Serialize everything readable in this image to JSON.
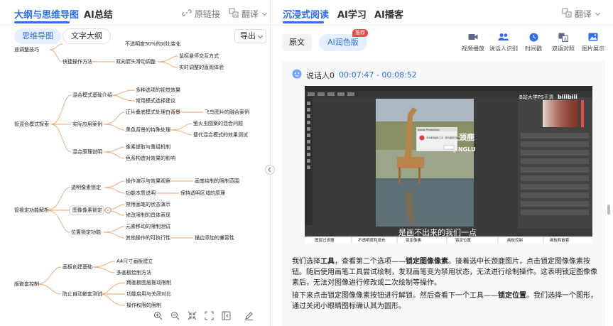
{
  "left": {
    "tabs": [
      "大纲与思维导图",
      "AI总结"
    ],
    "actions": {
      "link": "原链接",
      "translate": "翻译"
    },
    "view_modes": [
      "思维导图",
      "文字大纲"
    ],
    "export": "导出"
  },
  "mindmap": {
    "n1": "不透明度50%的对比变化",
    "n2": "遥调整技巧",
    "n3": "快捷操作方法",
    "n4": "双向箭头滑动调整",
    "n5": "鼠标悬停交互方式",
    "n6": "实时调整的直观体验",
    "n7": "混合模式基础介绍",
    "n8": "多种选项的视觉效果",
    "n9": "常用模式选择建议",
    "n10": "管混合模式探索",
    "n11": "实际应用案例",
    "n12": "正片叠底模式处理白背景",
    "n13": "飞鸟图片的融合案例",
    "n14": "黑色背景的特殊处理",
    "n15": "萤火虫图案的混合问题",
    "n16": "替代混合模式的效果测试",
    "n17": "混合原理说明",
    "n18": "像素提取与重组机制",
    "n19": "色系构造对效果的影响",
    "n20": "透明像素锁定",
    "n21": "操作演示与效果观察",
    "n22": "画笔绘制的限制范围",
    "n23": "功能本质说明",
    "n24": "保持透明区域的原理",
    "n25": "管锁定功能解析",
    "n26": "图像像素锁定",
    "n27": "禁用画笔的状态演示",
    "n28": "修改限制的具体表现",
    "n29": "位置锁定功能",
    "n30": "元素移动的限制测试",
    "n31": "其他操作的可执行性",
    "n32": "描边添加的兼容性",
    "n33": "画板创建基础",
    "n34": "A4尺寸画板建立",
    "n35": "多画板绘制方法",
    "n36": "版嵌套控制",
    "n37": "防止自动嵌套测试",
    "n38": "跨画板图层拖动限制",
    "n39": "功能启用与关闭对比",
    "n40": "操作权限的限制"
  },
  "right": {
    "tabs": [
      "沉浸式阅读",
      "AI学习",
      "AI播客"
    ],
    "translate": "翻译",
    "pill_original": "原文",
    "pill_ai": "AI润色版",
    "badge": "推荐",
    "tools": [
      "视频播放",
      "说话人识别",
      "时间戳",
      "双语对照",
      "图片展示"
    ],
    "speaker": {
      "name": "说话人0",
      "time": "00:07:47 - 00:08:52"
    },
    "video": {
      "watermark": "B站大学PS干货",
      "brand": "bilibili",
      "subtitle": "是画不出来的我们一点",
      "canvas_title": "长颈鹿",
      "canvas_sub": "CHANGJINGLU",
      "dialog_title": "Adobe Photoshop",
      "dialog_text": "无法使用画笔工具（因为图层已锁定）",
      "bar": [
        "图层过滤器",
        "不透明度和填充",
        "锁定像素",
        "锁定位置",
        "画板控制",
        "画板和嵌套"
      ]
    },
    "para1": [
      {
        "t": "我们选择",
        "b": false
      },
      {
        "t": "工具",
        "b": true
      },
      {
        "t": "，查看第二个选项——",
        "b": false
      },
      {
        "t": "锁定图像像素",
        "b": true
      },
      {
        "t": "。接着选中长颈鹿图片，点击锁定图像像素按钮。随后使用画笔工具尝试绘制，发现画笔变为禁用状态，无法进行绘制操作。这表明锁定图像像素后，无法对图像进行修改或二次绘制等操作。",
        "b": false
      }
    ],
    "para2": [
      {
        "t": "接下来点击锁定图像像素按钮进行解锁。然后查看下一个工具——",
        "b": false
      },
      {
        "t": "锁定位置",
        "b": true
      },
      {
        "t": "。我们选择一个图形，通过关闭小眼睛图标确认其为圆形。",
        "b": false
      }
    ]
  },
  "colors": {
    "accent": "#2d6cf6",
    "badge": "#f04a4a",
    "line": "#f0a36a"
  }
}
